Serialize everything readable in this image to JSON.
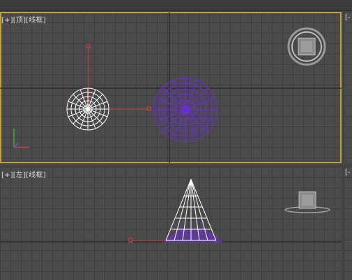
{
  "title_bar": {
    "text": ""
  },
  "viewports": {
    "top": {
      "label_plus": "[+]",
      "label_view": "[顶]",
      "label_shading": "[线框]"
    },
    "left": {
      "label_plus": "[+]",
      "label_view": "[左]",
      "label_shading": "[线框]"
    },
    "right_edge_label": "[-"
  },
  "colors": {
    "active_border": "#c2a234",
    "viewport_bg": "#4b4b4b",
    "grid_line": "#3e3e3e",
    "axis_line": "#1a1a1a",
    "gizmo_red": "#d23c3c",
    "light_purple": "#6a2fcf",
    "wireframe_white": "#ffffff"
  },
  "icons": {
    "view_cube": "view-cube-icon",
    "axis_tripod": "axis-tripod-icon"
  }
}
